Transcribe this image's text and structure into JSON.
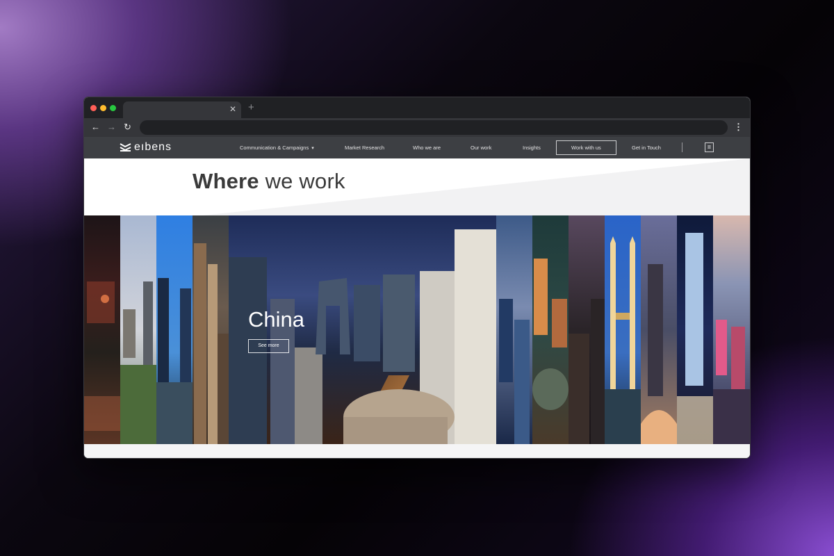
{
  "site": {
    "brand": "eıbens",
    "nav": [
      {
        "label": "Communication & Campaigns",
        "has_dropdown": true
      },
      {
        "label": "Market Research"
      },
      {
        "label": "Who we are"
      },
      {
        "label": "Our work"
      },
      {
        "label": "Insights"
      },
      {
        "label": "Work with us",
        "outlined": true
      },
      {
        "label": "Get in Touch"
      }
    ],
    "lang_icon": "book-icon"
  },
  "hero": {
    "heading_plain": "Where",
    "heading_highlight": "we work",
    "highlight_color": "#f0b8bf"
  },
  "featured": {
    "country": "China",
    "cta": "See more"
  },
  "colors": {
    "nav_bg": "#3d3f43",
    "browser_frame": "#202124",
    "toolbar": "#35363a"
  }
}
